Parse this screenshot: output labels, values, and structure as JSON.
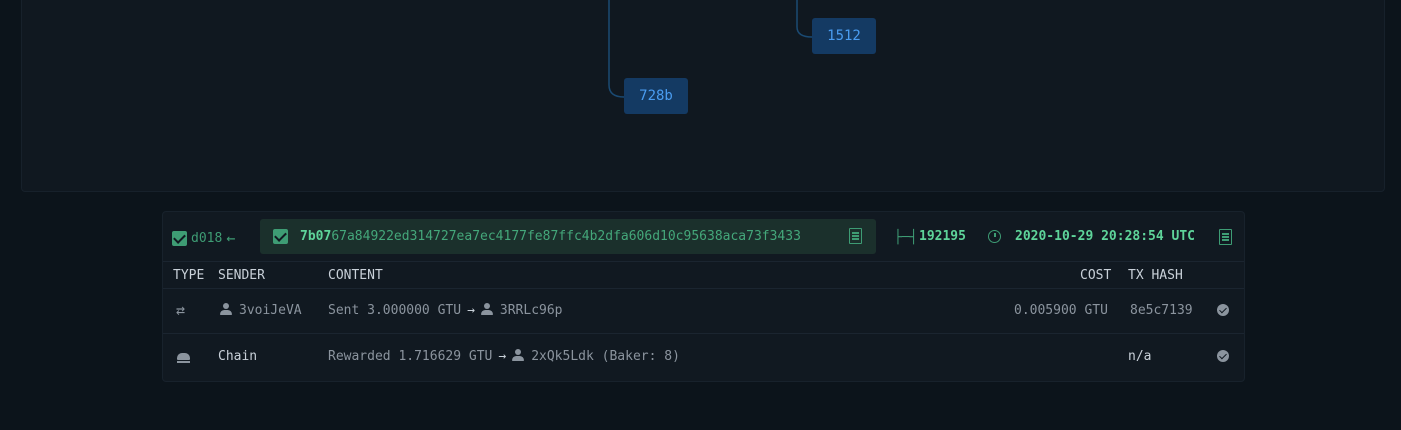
{
  "graph": {
    "nodes": [
      {
        "label": "1512"
      },
      {
        "label": "728b"
      }
    ],
    "link_color": "#1a4a73",
    "node_bg": "#143a63",
    "node_text_color": "#4a9cf0"
  },
  "block": {
    "prev_hash": "d018",
    "prev_arrow": "←",
    "hash_bold": "7b07",
    "hash_rest": "67a84922ed314727ea7ec4177fe87ffc4b2dfa606d10c95638aca73f3433",
    "height": "192195",
    "time": "2020-10-29 20:28:54 UTC",
    "accent_color": "#3e9c74"
  },
  "table": {
    "columns": {
      "type": "TYPE",
      "sender": "SENDER",
      "content": "CONTENT",
      "cost": "COST",
      "tx_hash": "TX HASH"
    },
    "rows": [
      {
        "type_icon": "transfer-icon",
        "sender": "3voiJeVA",
        "content_prefix": "Sent 3.000000 GTU",
        "arrow": "→",
        "recipient": "3RRLc96p",
        "recipient_suffix": "",
        "cost": "0.005900 GTU",
        "tx_hash": "8e5c7139",
        "status_icon": "check-circle-icon"
      },
      {
        "type_icon": "baker-icon",
        "sender": "Chain",
        "content_prefix": "Rewarded 1.716629 GTU",
        "arrow": "→",
        "recipient": "2xQk5Ldk",
        "recipient_suffix": " (Baker: 8)",
        "cost": "",
        "tx_hash": "n/a",
        "status_icon": "check-circle-icon"
      }
    ]
  }
}
